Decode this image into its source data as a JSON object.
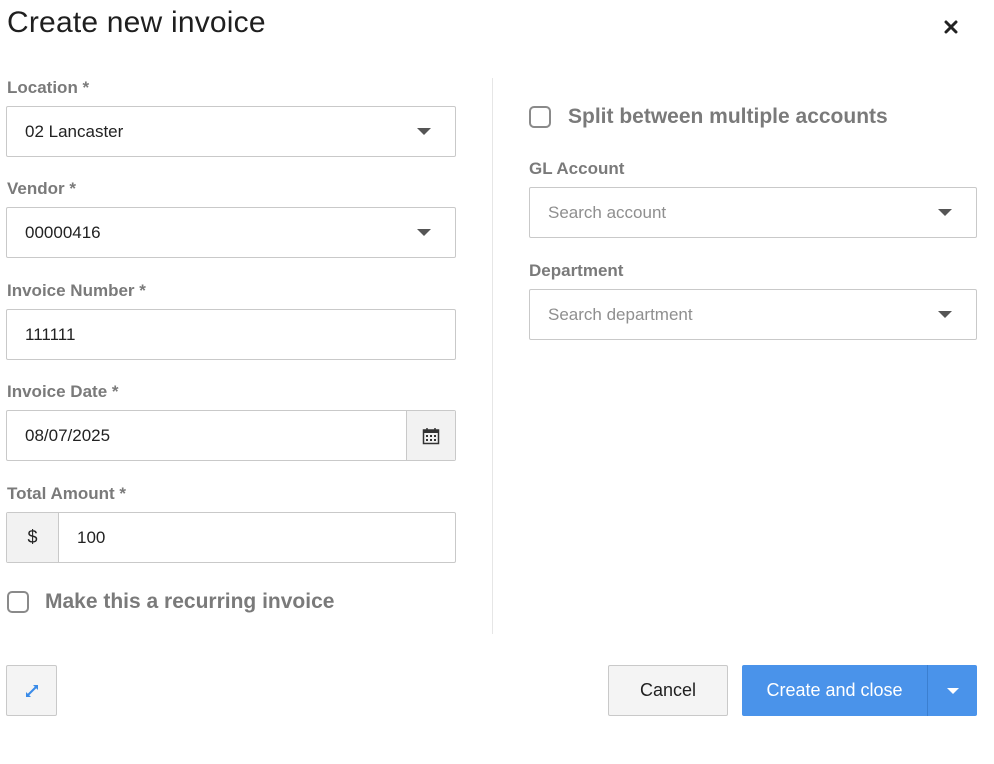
{
  "dialog": {
    "title": "Create new invoice"
  },
  "form": {
    "location": {
      "label": "Location *",
      "value": "02 Lancaster"
    },
    "vendor": {
      "label": "Vendor *",
      "value": "00000416"
    },
    "invoice_number": {
      "label": "Invoice Number *",
      "value": "111111"
    },
    "invoice_date": {
      "label": "Invoice Date *",
      "value": "08/07/2025"
    },
    "total_amount": {
      "label": "Total Amount *",
      "currency": "$",
      "value": "100"
    },
    "recurring": {
      "label": "Make this a recurring invoice",
      "checked": false
    },
    "split": {
      "label": "Split between multiple accounts",
      "checked": false
    },
    "gl_account": {
      "label": "GL Account",
      "placeholder": "Search account"
    },
    "department": {
      "label": "Department",
      "placeholder": "Search department"
    }
  },
  "footer": {
    "cancel_label": "Cancel",
    "create_label": "Create and close"
  },
  "colors": {
    "primary": "#4a93ea",
    "expand_icon": "#3a8be8"
  }
}
